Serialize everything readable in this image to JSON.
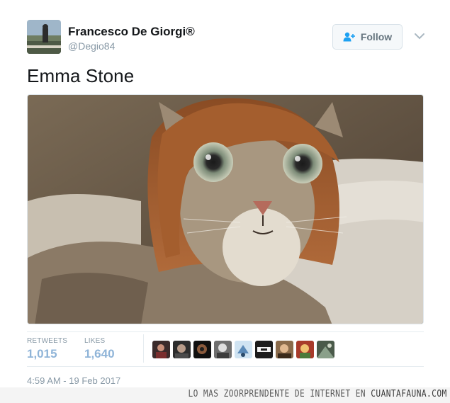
{
  "author": {
    "display_name": "Francesco De Giorgi®",
    "handle": "@Degio84",
    "avatar_icon": "profile-photo"
  },
  "follow_button": {
    "label": "Follow",
    "icon": "add-user-icon"
  },
  "more_menu_icon": "chevron-down-icon",
  "tweet": {
    "text": "Emma Stone",
    "image_description_icon": "photo-cat-with-wig"
  },
  "stats": {
    "retweets_label": "RETWEETS",
    "retweets_value": "1,015",
    "likes_label": "LIKES",
    "likes_value": "1,640"
  },
  "likers": [
    "liker-avatar-1",
    "liker-avatar-2",
    "liker-avatar-3",
    "liker-avatar-4",
    "liker-avatar-5",
    "liker-avatar-6",
    "liker-avatar-7",
    "liker-avatar-8",
    "liker-avatar-9"
  ],
  "timestamp": "4:59 AM - 19 Feb 2017",
  "watermark": {
    "prefix": "LO MAS ZOORPRENDENTE DE INTERNET EN ",
    "brand": "CUANTAFAUNA.COM"
  },
  "colors": {
    "stat_value": "#8fb4d8",
    "muted": "#8899a6",
    "text": "#14171a"
  }
}
